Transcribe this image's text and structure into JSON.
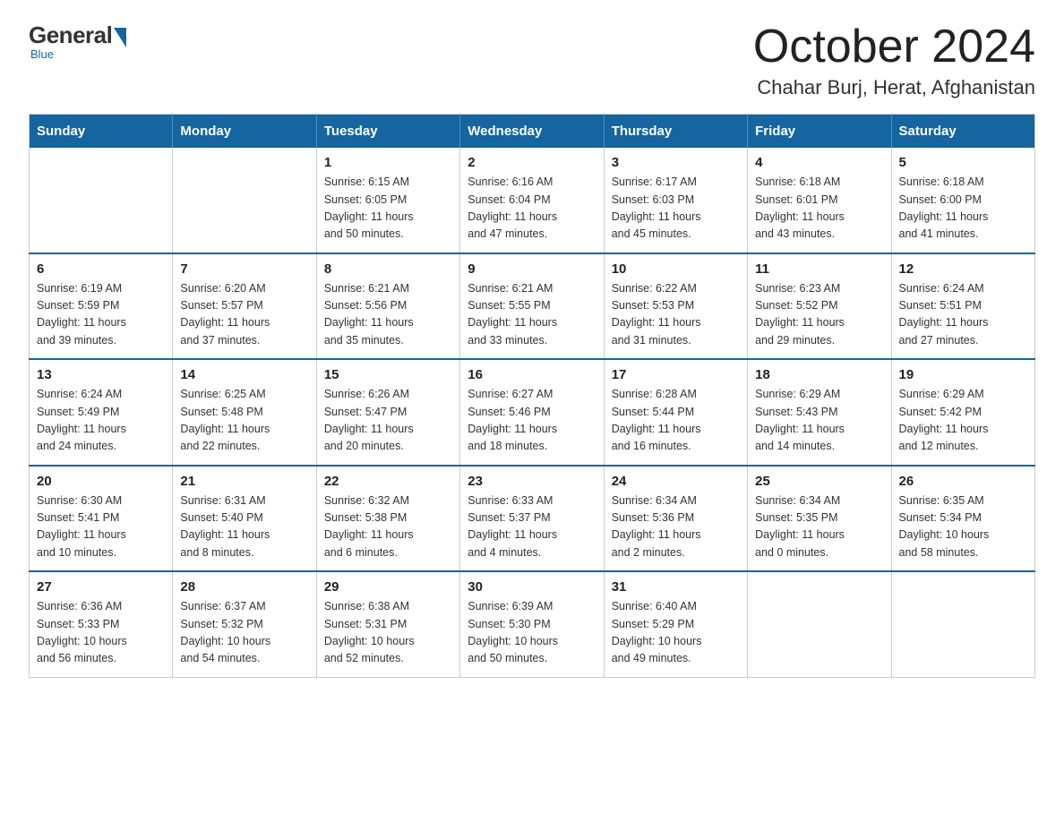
{
  "logo": {
    "general": "General",
    "blue": "Blue",
    "subtitle": "Blue"
  },
  "title": "October 2024",
  "location": "Chahar Burj, Herat, Afghanistan",
  "weekdays": [
    "Sunday",
    "Monday",
    "Tuesday",
    "Wednesday",
    "Thursday",
    "Friday",
    "Saturday"
  ],
  "weeks": [
    [
      {
        "day": "",
        "info": ""
      },
      {
        "day": "",
        "info": ""
      },
      {
        "day": "1",
        "info": "Sunrise: 6:15 AM\nSunset: 6:05 PM\nDaylight: 11 hours\nand 50 minutes."
      },
      {
        "day": "2",
        "info": "Sunrise: 6:16 AM\nSunset: 6:04 PM\nDaylight: 11 hours\nand 47 minutes."
      },
      {
        "day": "3",
        "info": "Sunrise: 6:17 AM\nSunset: 6:03 PM\nDaylight: 11 hours\nand 45 minutes."
      },
      {
        "day": "4",
        "info": "Sunrise: 6:18 AM\nSunset: 6:01 PM\nDaylight: 11 hours\nand 43 minutes."
      },
      {
        "day": "5",
        "info": "Sunrise: 6:18 AM\nSunset: 6:00 PM\nDaylight: 11 hours\nand 41 minutes."
      }
    ],
    [
      {
        "day": "6",
        "info": "Sunrise: 6:19 AM\nSunset: 5:59 PM\nDaylight: 11 hours\nand 39 minutes."
      },
      {
        "day": "7",
        "info": "Sunrise: 6:20 AM\nSunset: 5:57 PM\nDaylight: 11 hours\nand 37 minutes."
      },
      {
        "day": "8",
        "info": "Sunrise: 6:21 AM\nSunset: 5:56 PM\nDaylight: 11 hours\nand 35 minutes."
      },
      {
        "day": "9",
        "info": "Sunrise: 6:21 AM\nSunset: 5:55 PM\nDaylight: 11 hours\nand 33 minutes."
      },
      {
        "day": "10",
        "info": "Sunrise: 6:22 AM\nSunset: 5:53 PM\nDaylight: 11 hours\nand 31 minutes."
      },
      {
        "day": "11",
        "info": "Sunrise: 6:23 AM\nSunset: 5:52 PM\nDaylight: 11 hours\nand 29 minutes."
      },
      {
        "day": "12",
        "info": "Sunrise: 6:24 AM\nSunset: 5:51 PM\nDaylight: 11 hours\nand 27 minutes."
      }
    ],
    [
      {
        "day": "13",
        "info": "Sunrise: 6:24 AM\nSunset: 5:49 PM\nDaylight: 11 hours\nand 24 minutes."
      },
      {
        "day": "14",
        "info": "Sunrise: 6:25 AM\nSunset: 5:48 PM\nDaylight: 11 hours\nand 22 minutes."
      },
      {
        "day": "15",
        "info": "Sunrise: 6:26 AM\nSunset: 5:47 PM\nDaylight: 11 hours\nand 20 minutes."
      },
      {
        "day": "16",
        "info": "Sunrise: 6:27 AM\nSunset: 5:46 PM\nDaylight: 11 hours\nand 18 minutes."
      },
      {
        "day": "17",
        "info": "Sunrise: 6:28 AM\nSunset: 5:44 PM\nDaylight: 11 hours\nand 16 minutes."
      },
      {
        "day": "18",
        "info": "Sunrise: 6:29 AM\nSunset: 5:43 PM\nDaylight: 11 hours\nand 14 minutes."
      },
      {
        "day": "19",
        "info": "Sunrise: 6:29 AM\nSunset: 5:42 PM\nDaylight: 11 hours\nand 12 minutes."
      }
    ],
    [
      {
        "day": "20",
        "info": "Sunrise: 6:30 AM\nSunset: 5:41 PM\nDaylight: 11 hours\nand 10 minutes."
      },
      {
        "day": "21",
        "info": "Sunrise: 6:31 AM\nSunset: 5:40 PM\nDaylight: 11 hours\nand 8 minutes."
      },
      {
        "day": "22",
        "info": "Sunrise: 6:32 AM\nSunset: 5:38 PM\nDaylight: 11 hours\nand 6 minutes."
      },
      {
        "day": "23",
        "info": "Sunrise: 6:33 AM\nSunset: 5:37 PM\nDaylight: 11 hours\nand 4 minutes."
      },
      {
        "day": "24",
        "info": "Sunrise: 6:34 AM\nSunset: 5:36 PM\nDaylight: 11 hours\nand 2 minutes."
      },
      {
        "day": "25",
        "info": "Sunrise: 6:34 AM\nSunset: 5:35 PM\nDaylight: 11 hours\nand 0 minutes."
      },
      {
        "day": "26",
        "info": "Sunrise: 6:35 AM\nSunset: 5:34 PM\nDaylight: 10 hours\nand 58 minutes."
      }
    ],
    [
      {
        "day": "27",
        "info": "Sunrise: 6:36 AM\nSunset: 5:33 PM\nDaylight: 10 hours\nand 56 minutes."
      },
      {
        "day": "28",
        "info": "Sunrise: 6:37 AM\nSunset: 5:32 PM\nDaylight: 10 hours\nand 54 minutes."
      },
      {
        "day": "29",
        "info": "Sunrise: 6:38 AM\nSunset: 5:31 PM\nDaylight: 10 hours\nand 52 minutes."
      },
      {
        "day": "30",
        "info": "Sunrise: 6:39 AM\nSunset: 5:30 PM\nDaylight: 10 hours\nand 50 minutes."
      },
      {
        "day": "31",
        "info": "Sunrise: 6:40 AM\nSunset: 5:29 PM\nDaylight: 10 hours\nand 49 minutes."
      },
      {
        "day": "",
        "info": ""
      },
      {
        "day": "",
        "info": ""
      }
    ]
  ]
}
